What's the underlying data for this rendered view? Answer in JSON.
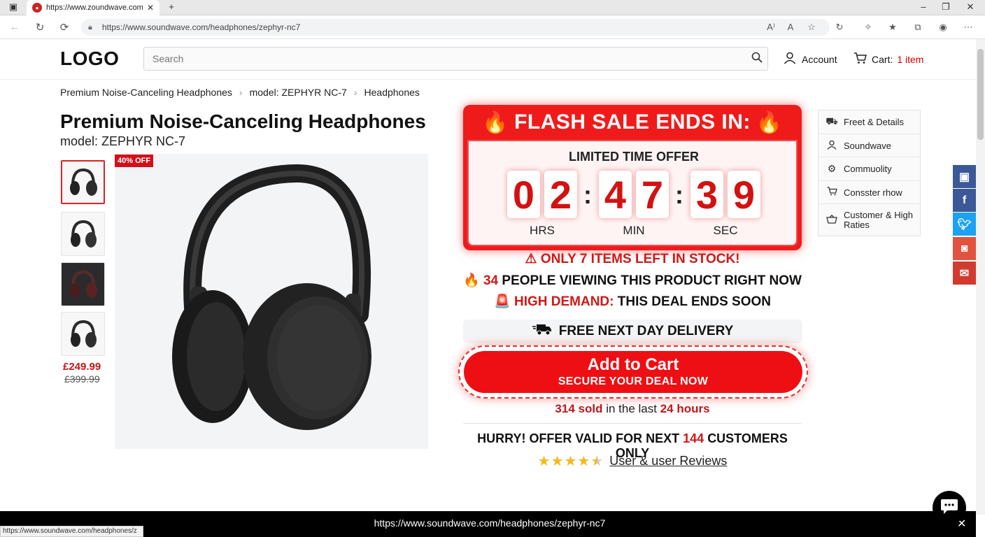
{
  "browser": {
    "tab_title": "https://www.zoundwave.com/",
    "url": "https://www.soundwave.com/headphones/zephyr-nc7"
  },
  "header": {
    "logo": "LOGO",
    "search_placeholder": "Search",
    "account_label": "Account",
    "cart_label": "Cart:",
    "cart_count": "1 item"
  },
  "breadcrumb": [
    "Premium Noise-Canceling Headphones",
    "model: ZEPHYR NC-7",
    "Headphones"
  ],
  "product": {
    "title": "Premium Noise-Canceling Headphones",
    "model": "model: ZEPHYR NC-7",
    "discount_badge": "40% OFF",
    "price_new": "£249.99",
    "price_old": "£399.99"
  },
  "flash_sale": {
    "title": "FLASH SALE ENDS IN:",
    "subtitle": "LIMITED TIME OFFER",
    "hours": [
      "0",
      "2"
    ],
    "minutes": [
      "4",
      "7"
    ],
    "seconds": [
      "3",
      "9"
    ],
    "unit_hrs": "HRS",
    "unit_min": "MIN",
    "unit_sec": "SEC"
  },
  "urgency": {
    "stock": "ONLY 7 ITEMS LEFT IN STOCK!",
    "viewers_count": "34",
    "viewers_text": "PEOPLE VIEWING THIS PRODUCT RIGHT NOW",
    "demand_label": "HIGH DEMAND:",
    "demand_text": "THIS DEAL ENDS SOON"
  },
  "delivery": "FREE NEXT DAY DELIVERY",
  "cta": {
    "line1": "Add to Cart",
    "line2": "SECURE YOUR DEAL NOW"
  },
  "sold": {
    "count": "314 sold",
    "middle": "in the last",
    "period": "24 hours"
  },
  "hurry": {
    "before": "HURRY! OFFER VALID FOR NEXT",
    "count": "144",
    "after": "CUSTOMERS ONLY"
  },
  "reviews": {
    "rating": 4.5,
    "link": "User & user Reviews"
  },
  "side_menu": [
    {
      "icon": "truck-icon",
      "label": "Freet & Details"
    },
    {
      "icon": "user-icon",
      "label": "Soundwave"
    },
    {
      "icon": "gear-icon",
      "label": "Commuolity"
    },
    {
      "icon": "cart-icon",
      "label": "Consster rhow"
    },
    {
      "icon": "basket-icon",
      "label": "Customer & High Raties"
    }
  ],
  "share_colors": {
    "save": "#3b5998",
    "facebook": "#3b5998",
    "twitter": "#1da1f2",
    "instagram": "#e1533e",
    "mail": "#d23a2f"
  },
  "bottom_bar": {
    "url": "https://www.soundwave.com/headphones/zephyr-nc7",
    "status_url": "https://www.soundwave.com/headphones/z"
  },
  "colors": {
    "accent_red": "#ee0f14",
    "price_red": "#c0161b"
  }
}
